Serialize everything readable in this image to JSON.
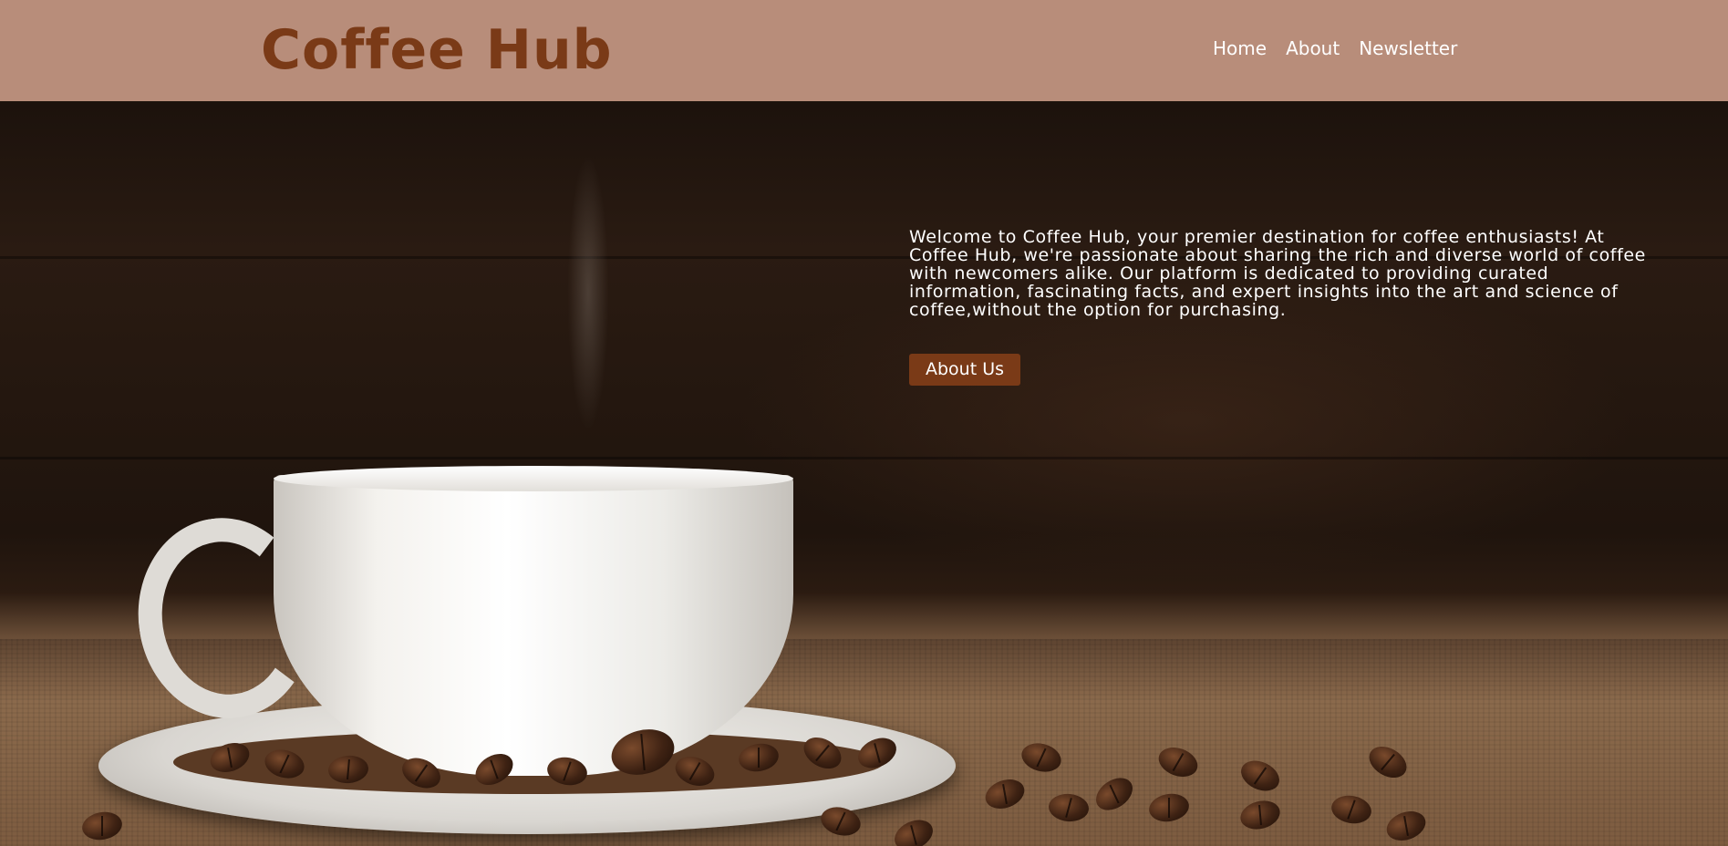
{
  "header": {
    "logo": "Coffee Hub",
    "nav": [
      {
        "label": "Home"
      },
      {
        "label": "About"
      },
      {
        "label": "Newsletter"
      }
    ]
  },
  "hero": {
    "description": "Welcome to Coffee Hub, your premier destination for coffee enthusiasts! At Coffee Hub, we're passionate about sharing the rich and diverse world of coffee with newcomers alike. Our platform is dedicated to providing curated information, fascinating facts, and expert insights into the art and science of coffee,without the option for purchasing.",
    "cta_label": "About Us"
  },
  "colors": {
    "header_bg": "#b88d7a",
    "brand": "#7a3a17",
    "button_bg": "#7a3a17",
    "text_light": "#ffffff"
  }
}
